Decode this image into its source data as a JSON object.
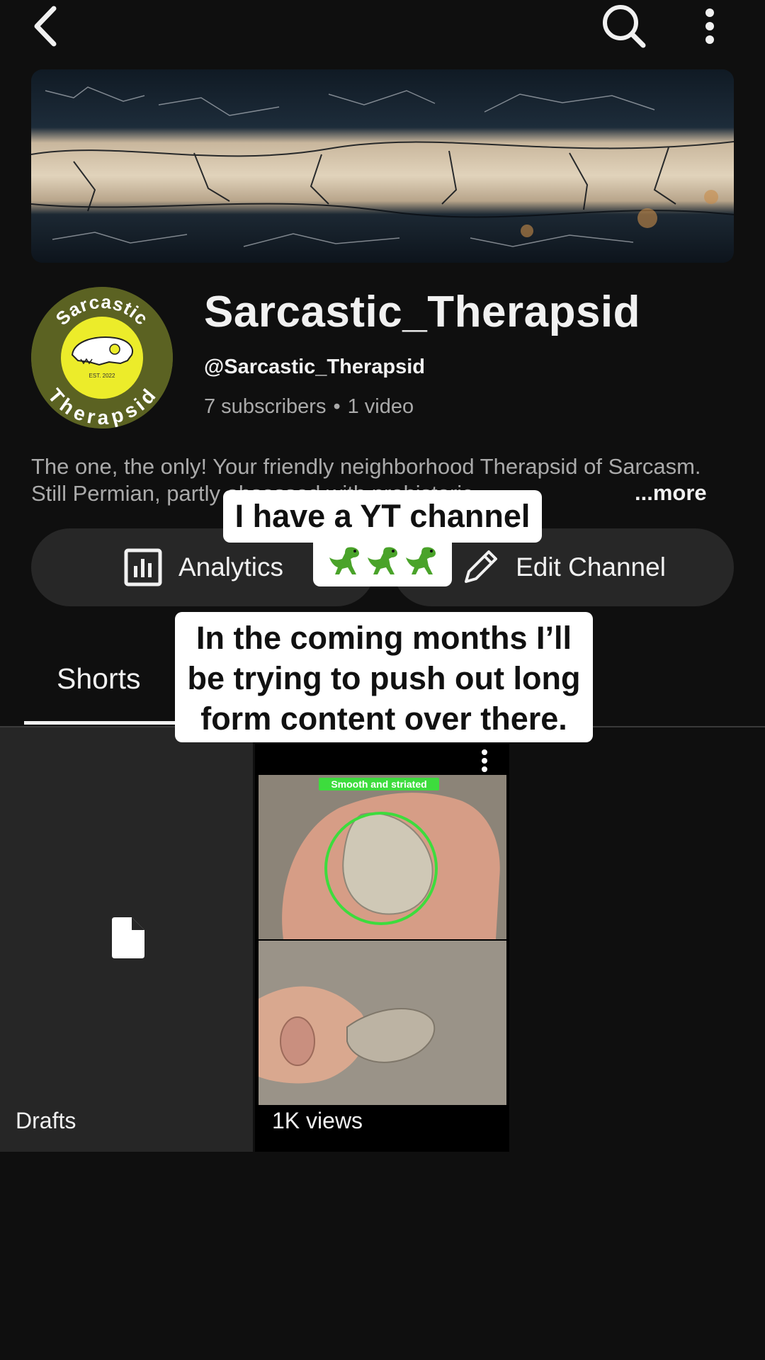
{
  "topbar": {
    "back_icon": "chevron-left-icon",
    "search_icon": "search-icon",
    "more_icon": "more-vertical-icon"
  },
  "channel": {
    "name": "Sarcastic_Therapsid",
    "handle": "@Sarcastic_Therapsid",
    "subscribers": "7 subscribers",
    "separator": "•",
    "videos": "1 video",
    "description": "The one, the only! Your friendly neighborhood Therapsid of Sarcasm. Still Permian, partly obsessed with prehistoric",
    "more_label": "...more",
    "avatar": {
      "top_text": "Sarcastic",
      "bottom_text": "Therapsid",
      "est": "EST. 2022",
      "ring_color": "#5b6222",
      "center_color": "#ecec2a"
    }
  },
  "actions": {
    "analytics_label": "Analytics",
    "edit_label": "Edit Channel"
  },
  "tabs": [
    {
      "label": "Shorts",
      "selected": true
    }
  ],
  "grid": {
    "drafts_label": "Drafts",
    "short": {
      "caption": "Smooth and striated",
      "views": "1K views"
    }
  },
  "overlay": {
    "caption_1": "I have a YT channel",
    "caption_1_emoji": "🦖🦖🦖",
    "caption_2_line1": "In the coming months I’ll",
    "caption_2_line2": "be trying to push out long",
    "caption_2_line3": "form content over there."
  },
  "colors": {
    "background": "#0f0f0f",
    "button_bg": "#272727",
    "muted_text": "#aaaaaa",
    "accent_green": "#3ddc3d"
  }
}
